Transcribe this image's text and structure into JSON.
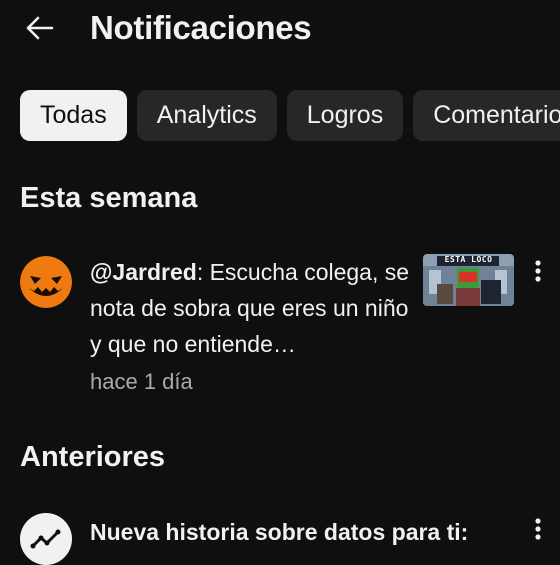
{
  "header": {
    "title": "Notificaciones",
    "back_icon": "arrow-left-icon"
  },
  "filters": [
    {
      "label": "Todas",
      "selected": true
    },
    {
      "label": "Analytics",
      "selected": false
    },
    {
      "label": "Logros",
      "selected": false
    },
    {
      "label": "Comentarios",
      "selected": false
    }
  ],
  "sections": {
    "this_week": "Esta semana",
    "older": "Anteriores"
  },
  "notifications": [
    {
      "handle": "@Jardred",
      "message": ": Escucha colega, se nota de sobra que eres un niño y que no entiende…",
      "time": "hace 1 día",
      "thumbnail_text": "ESTA LOCO",
      "avatar": "pumpkin-avatar"
    },
    {
      "message": "Nueva historia sobre datos para ti:",
      "avatar": "analytics-trend-avatar"
    }
  ],
  "colors": {
    "background": "#0f0f0f",
    "chip": "#272727",
    "chip_active": "#f1f1f1",
    "text": "#f1f1f1",
    "secondary_text": "#aaaaaa",
    "avatar_orange": "#f07a12"
  }
}
